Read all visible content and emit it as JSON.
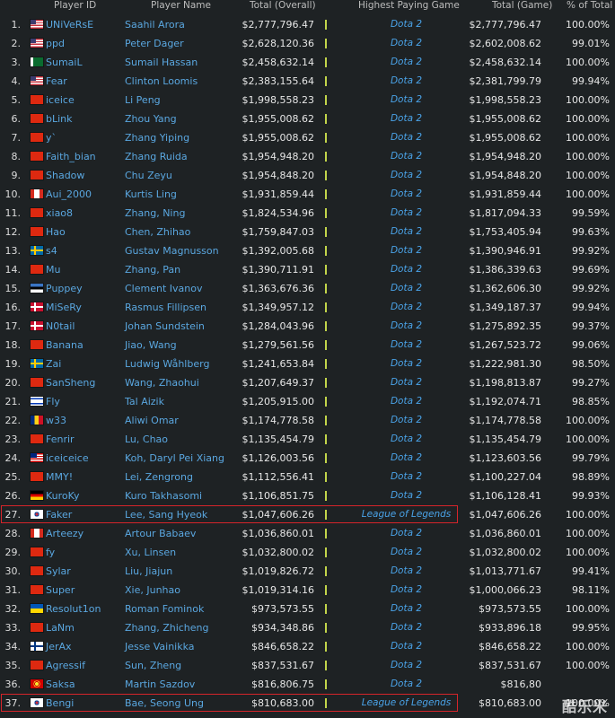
{
  "headers": {
    "player_id": "Player ID",
    "player_name": "Player Name",
    "total_overall": "Total (Overall)",
    "highest_game": "Highest Paying Game",
    "total_game": "Total (Game)",
    "pct_total": "% of Total"
  },
  "rows": [
    {
      "rank": "1.",
      "flag": "us",
      "id": "UNiVeRsE",
      "name": "Saahil Arora",
      "total": "$2,777,796.47",
      "game": "Dota 2",
      "game_total": "$2,777,796.47",
      "pct": "100.00%"
    },
    {
      "rank": "2.",
      "flag": "us",
      "id": "ppd",
      "name": "Peter Dager",
      "total": "$2,628,120.36",
      "game": "Dota 2",
      "game_total": "$2,602,008.62",
      "pct": "99.01%"
    },
    {
      "rank": "3.",
      "flag": "pk",
      "id": "SumaiL",
      "name": "Sumail Hassan",
      "total": "$2,458,632.14",
      "game": "Dota 2",
      "game_total": "$2,458,632.14",
      "pct": "100.00%"
    },
    {
      "rank": "4.",
      "flag": "us",
      "id": "Fear",
      "name": "Clinton Loomis",
      "total": "$2,383,155.64",
      "game": "Dota 2",
      "game_total": "$2,381,799.79",
      "pct": "99.94%"
    },
    {
      "rank": "5.",
      "flag": "cn",
      "id": "iceice",
      "name": "Li Peng",
      "total": "$1,998,558.23",
      "game": "Dota 2",
      "game_total": "$1,998,558.23",
      "pct": "100.00%"
    },
    {
      "rank": "6.",
      "flag": "cn",
      "id": "bLink",
      "name": "Zhou Yang",
      "total": "$1,955,008.62",
      "game": "Dota 2",
      "game_total": "$1,955,008.62",
      "pct": "100.00%"
    },
    {
      "rank": "7.",
      "flag": "cn",
      "id": "y`",
      "name": "Zhang Yiping",
      "total": "$1,955,008.62",
      "game": "Dota 2",
      "game_total": "$1,955,008.62",
      "pct": "100.00%"
    },
    {
      "rank": "8.",
      "flag": "cn",
      "id": "Faith_bian",
      "name": "Zhang Ruida",
      "total": "$1,954,948.20",
      "game": "Dota 2",
      "game_total": "$1,954,948.20",
      "pct": "100.00%"
    },
    {
      "rank": "9.",
      "flag": "cn",
      "id": "Shadow",
      "name": "Chu Zeyu",
      "total": "$1,954,848.20",
      "game": "Dota 2",
      "game_total": "$1,954,848.20",
      "pct": "100.00%"
    },
    {
      "rank": "10.",
      "flag": "ca",
      "id": "Aui_2000",
      "name": "Kurtis Ling",
      "total": "$1,931,859.44",
      "game": "Dota 2",
      "game_total": "$1,931,859.44",
      "pct": "100.00%"
    },
    {
      "rank": "11.",
      "flag": "cn",
      "id": "xiao8",
      "name": "Zhang, Ning",
      "total": "$1,824,534.96",
      "game": "Dota 2",
      "game_total": "$1,817,094.33",
      "pct": "99.59%"
    },
    {
      "rank": "12.",
      "flag": "cn",
      "id": "Hao",
      "name": "Chen, Zhihao",
      "total": "$1,759,847.03",
      "game": "Dota 2",
      "game_total": "$1,753,405.94",
      "pct": "99.63%"
    },
    {
      "rank": "13.",
      "flag": "se",
      "id": "s4",
      "name": "Gustav Magnusson",
      "total": "$1,392,005.68",
      "game": "Dota 2",
      "game_total": "$1,390,946.91",
      "pct": "99.92%"
    },
    {
      "rank": "14.",
      "flag": "cn",
      "id": "Mu",
      "name": "Zhang, Pan",
      "total": "$1,390,711.91",
      "game": "Dota 2",
      "game_total": "$1,386,339.63",
      "pct": "99.69%"
    },
    {
      "rank": "15.",
      "flag": "ee",
      "id": "Puppey",
      "name": "Clement Ivanov",
      "total": "$1,363,676.36",
      "game": "Dota 2",
      "game_total": "$1,362,606.30",
      "pct": "99.92%"
    },
    {
      "rank": "16.",
      "flag": "dk",
      "id": "MiSeRy",
      "name": "Rasmus Fillipsen",
      "total": "$1,349,957.12",
      "game": "Dota 2",
      "game_total": "$1,349,187.37",
      "pct": "99.94%"
    },
    {
      "rank": "17.",
      "flag": "dk",
      "id": "N0tail",
      "name": "Johan Sundstein",
      "total": "$1,284,043.96",
      "game": "Dota 2",
      "game_total": "$1,275,892.35",
      "pct": "99.37%"
    },
    {
      "rank": "18.",
      "flag": "cn",
      "id": "Banana",
      "name": "Jiao, Wang",
      "total": "$1,279,561.56",
      "game": "Dota 2",
      "game_total": "$1,267,523.72",
      "pct": "99.06%"
    },
    {
      "rank": "19.",
      "flag": "se",
      "id": "Zai",
      "name": "Ludwig Wåhlberg",
      "total": "$1,241,653.84",
      "game": "Dota 2",
      "game_total": "$1,222,981.30",
      "pct": "98.50%"
    },
    {
      "rank": "20.",
      "flag": "cn",
      "id": "SanSheng",
      "name": "Wang, Zhaohui",
      "total": "$1,207,649.37",
      "game": "Dota 2",
      "game_total": "$1,198,813.87",
      "pct": "99.27%"
    },
    {
      "rank": "21.",
      "flag": "il",
      "id": "Fly",
      "name": "Tal Aizik",
      "total": "$1,205,915.00",
      "game": "Dota 2",
      "game_total": "$1,192,074.71",
      "pct": "98.85%"
    },
    {
      "rank": "22.",
      "flag": "ro",
      "id": "w33",
      "name": "Aliwi Omar",
      "total": "$1,174,778.58",
      "game": "Dota 2",
      "game_total": "$1,174,778.58",
      "pct": "100.00%"
    },
    {
      "rank": "23.",
      "flag": "cn",
      "id": "Fenrir",
      "name": "Lu, Chao",
      "total": "$1,135,454.79",
      "game": "Dota 2",
      "game_total": "$1,135,454.79",
      "pct": "100.00%"
    },
    {
      "rank": "24.",
      "flag": "my",
      "id": "iceiceice",
      "name": "Koh, Daryl Pei Xiang",
      "total": "$1,126,003.56",
      "game": "Dota 2",
      "game_total": "$1,123,603.56",
      "pct": "99.79%"
    },
    {
      "rank": "25.",
      "flag": "cn",
      "id": "MMY!",
      "name": "Lei, Zengrong",
      "total": "$1,112,556.41",
      "game": "Dota 2",
      "game_total": "$1,100,227.04",
      "pct": "98.89%"
    },
    {
      "rank": "26.",
      "flag": "de",
      "id": "KuroKy",
      "name": "Kuro Takhasomi",
      "total": "$1,106,851.75",
      "game": "Dota 2",
      "game_total": "$1,106,128.41",
      "pct": "99.93%"
    },
    {
      "rank": "27.",
      "flag": "kr",
      "id": "Faker",
      "name": "Lee, Sang Hyeok",
      "total": "$1,047,606.26",
      "game": "League of Legends",
      "game_total": "$1,047,606.26",
      "pct": "100.00%",
      "highlight": true
    },
    {
      "rank": "28.",
      "flag": "ca",
      "id": "Arteezy",
      "name": "Artour Babaev",
      "total": "$1,036,860.01",
      "game": "Dota 2",
      "game_total": "$1,036,860.01",
      "pct": "100.00%"
    },
    {
      "rank": "29.",
      "flag": "cn",
      "id": "fy",
      "name": "Xu, Linsen",
      "total": "$1,032,800.02",
      "game": "Dota 2",
      "game_total": "$1,032,800.02",
      "pct": "100.00%"
    },
    {
      "rank": "30.",
      "flag": "cn",
      "id": "Sylar",
      "name": "Liu, Jiajun",
      "total": "$1,019,826.72",
      "game": "Dota 2",
      "game_total": "$1,013,771.67",
      "pct": "99.41%"
    },
    {
      "rank": "31.",
      "flag": "cn",
      "id": "Super",
      "name": "Xie, Junhao",
      "total": "$1,019,314.16",
      "game": "Dota 2",
      "game_total": "$1,000,066.23",
      "pct": "98.11%"
    },
    {
      "rank": "32.",
      "flag": "ua",
      "id": "Resolut1on",
      "name": "Roman Fominok",
      "total": "$973,573.55",
      "game": "Dota 2",
      "game_total": "$973,573.55",
      "pct": "100.00%"
    },
    {
      "rank": "33.",
      "flag": "cn",
      "id": "LaNm",
      "name": "Zhang, Zhicheng",
      "total": "$934,348.86",
      "game": "Dota 2",
      "game_total": "$933,896.18",
      "pct": "99.95%"
    },
    {
      "rank": "34.",
      "flag": "fi",
      "id": "JerAx",
      "name": "Jesse Vainikka",
      "total": "$846,658.22",
      "game": "Dota 2",
      "game_total": "$846,658.22",
      "pct": "100.00%"
    },
    {
      "rank": "35.",
      "flag": "cn",
      "id": "Agressif",
      "name": "Sun, Zheng",
      "total": "$837,531.67",
      "game": "Dota 2",
      "game_total": "$837,531.67",
      "pct": "100.00%"
    },
    {
      "rank": "36.",
      "flag": "mk",
      "id": "Saksa",
      "name": "Martin Sazdov",
      "total": "$816,806.75",
      "game": "Dota 2",
      "game_total": "$816,80",
      "pct": ""
    },
    {
      "rank": "37.",
      "flag": "kr",
      "id": "Bengi",
      "name": "Bae, Seong Ung",
      "total": "$810,683.00",
      "game": "League of Legends",
      "game_total": "$810,683.00",
      "pct": "100.00%",
      "highlight": true
    }
  ],
  "watermark": "酷乐米",
  "colors": {
    "background": "#1e2224",
    "link": "#5aa7e0",
    "separator": "#c2d54a",
    "highlight_border": "#d6242a"
  }
}
